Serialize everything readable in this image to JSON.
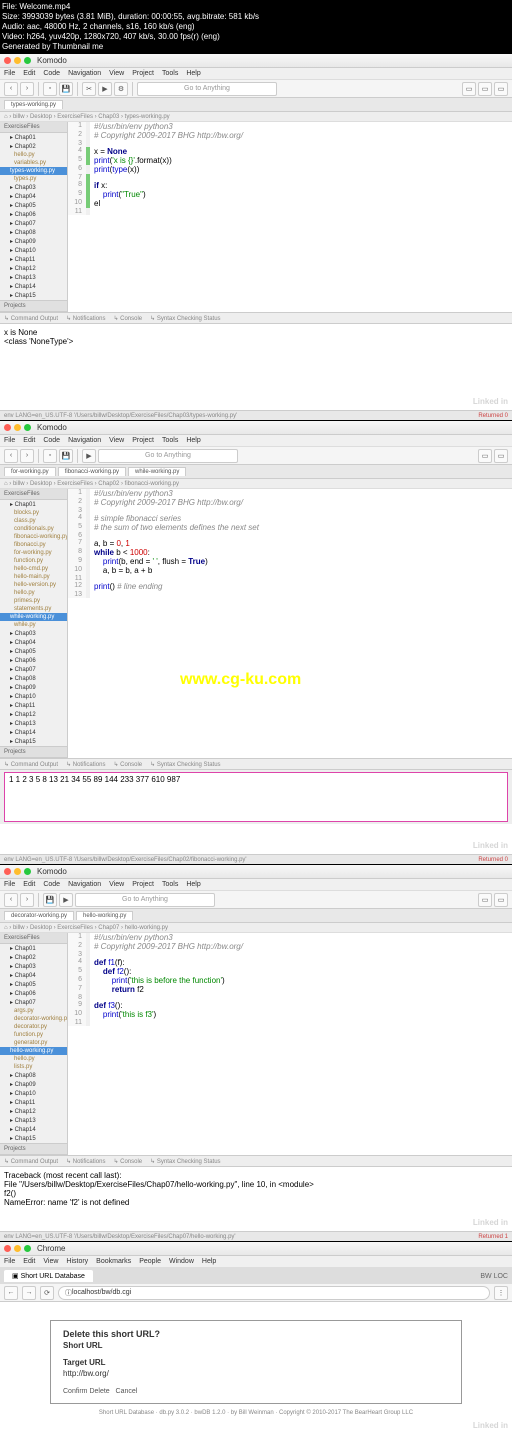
{
  "fileinfo": {
    "l1": "File: Welcome.mp4",
    "l2": "Size: 3993039 bytes (3.81 MiB), duration: 00:00:55, avg.bitrate: 581 kb/s",
    "l3": "Audio: aac, 48000 Hz, 2 channels, s16, 160 kb/s (eng)",
    "l4": "Video: h264, yuv420p, 1280x720, 407 kb/s, 30.00 fps(r) (eng)",
    "l5": "Generated by Thumbnail me"
  },
  "app": "Komodo",
  "menu": [
    "File",
    "Edit",
    "Code",
    "Navigation",
    "View",
    "Project",
    "Tools",
    "Help"
  ],
  "search_ph": "Go to Anything",
  "ide1": {
    "tab": "types-working.py",
    "sidebar_hdr": "ExerciseFiles",
    "items": [
      {
        "t": "Chap01",
        "c": "folder"
      },
      {
        "t": "Chap02",
        "c": "folder"
      },
      {
        "t": "hello.py",
        "c": "py"
      },
      {
        "t": "variables.py",
        "c": "py"
      },
      {
        "t": "types-working.py",
        "c": "sel"
      },
      {
        "t": "types.py",
        "c": "py"
      },
      {
        "t": "Chap03",
        "c": "folder"
      },
      {
        "t": "Chap04",
        "c": "folder"
      },
      {
        "t": "Chap05",
        "c": "folder"
      },
      {
        "t": "Chap06",
        "c": "folder"
      },
      {
        "t": "Chap07",
        "c": "folder"
      },
      {
        "t": "Chap08",
        "c": "folder"
      },
      {
        "t": "Chap09",
        "c": "folder"
      },
      {
        "t": "Chap10",
        "c": "folder"
      },
      {
        "t": "Chap11",
        "c": "folder"
      },
      {
        "t": "Chap12",
        "c": "folder"
      },
      {
        "t": "Chap13",
        "c": "folder"
      },
      {
        "t": "Chap14",
        "c": "folder"
      },
      {
        "t": "Chap15",
        "c": "folder"
      }
    ],
    "code": [
      {
        "n": "1",
        "g": "",
        "h": "<span class='com'>#!/usr/bin/env python3</span>"
      },
      {
        "n": "2",
        "g": "",
        "h": "<span class='com'># Copyright 2009-2017 BHG http://bw.org/</span>"
      },
      {
        "n": "3",
        "g": "",
        "h": ""
      },
      {
        "n": "4",
        "g": "green",
        "h": "x = <span class='kw'>None</span>"
      },
      {
        "n": "5",
        "g": "green",
        "h": "<span class='fn'>print</span>(<span class='str'>'x is {}'</span>.format(x))"
      },
      {
        "n": "6",
        "g": "",
        "h": "<span class='fn'>print</span>(<span class='fn'>type</span>(x))"
      },
      {
        "n": "7",
        "g": "green",
        "h": ""
      },
      {
        "n": "8",
        "g": "green",
        "h": "<span class='kw'>if</span> x:"
      },
      {
        "n": "9",
        "g": "green",
        "h": "    <span class='fn'>print</span>(<span class='str'>\"True\"</span>)"
      },
      {
        "n": "10",
        "g": "green",
        "h": "el"
      },
      {
        "n": "11",
        "g": "",
        "h": ""
      }
    ],
    "panel_tabs": [
      "Command Output",
      "Notifications",
      "Console",
      "Syntax Checking Status"
    ],
    "out1": "x is None",
    "out2": "<class 'NoneType'>",
    "status": "env LANG=en_US.UTF-8 '/Users/billw/Desktop/ExerciseFiles/Chap03/types-working.py'",
    "status_r": "Returned 0"
  },
  "ide2": {
    "tabs": [
      "for-working.py",
      "fibonacci-working.py",
      "while-working.py"
    ],
    "items": [
      {
        "t": "Chap01",
        "c": "folder"
      },
      {
        "t": "blocks.py",
        "c": "py"
      },
      {
        "t": "class.py",
        "c": "py"
      },
      {
        "t": "conditionals.py",
        "c": "py"
      },
      {
        "t": "fibonacci-working.py",
        "c": "py"
      },
      {
        "t": "fibonacci.py",
        "c": "py"
      },
      {
        "t": "for-working.py",
        "c": "py"
      },
      {
        "t": "function.py",
        "c": "py"
      },
      {
        "t": "hello-cmd.py",
        "c": "py"
      },
      {
        "t": "hello-main.py",
        "c": "py"
      },
      {
        "t": "hello-version.py",
        "c": "py"
      },
      {
        "t": "hello.py",
        "c": "py"
      },
      {
        "t": "primes.py",
        "c": "py"
      },
      {
        "t": "statements.py",
        "c": "py"
      },
      {
        "t": "while-working.py",
        "c": "sel"
      },
      {
        "t": "while.py",
        "c": "py"
      },
      {
        "t": "Chap03",
        "c": "folder"
      },
      {
        "t": "Chap04",
        "c": "folder"
      },
      {
        "t": "Chap05",
        "c": "folder"
      },
      {
        "t": "Chap06",
        "c": "folder"
      },
      {
        "t": "Chap07",
        "c": "folder"
      },
      {
        "t": "Chap08",
        "c": "folder"
      },
      {
        "t": "Chap09",
        "c": "folder"
      },
      {
        "t": "Chap10",
        "c": "folder"
      },
      {
        "t": "Chap11",
        "c": "folder"
      },
      {
        "t": "Chap12",
        "c": "folder"
      },
      {
        "t": "Chap13",
        "c": "folder"
      },
      {
        "t": "Chap14",
        "c": "folder"
      },
      {
        "t": "Chap15",
        "c": "folder"
      }
    ],
    "code": [
      {
        "n": "1",
        "h": "<span class='com'>#!/usr/bin/env python3</span>"
      },
      {
        "n": "2",
        "h": "<span class='com'># Copyright 2009-2017 BHG http://bw.org/</span>"
      },
      {
        "n": "3",
        "h": ""
      },
      {
        "n": "4",
        "h": "<span class='com'># simple fibonacci series</span>"
      },
      {
        "n": "5",
        "h": "<span class='com'># the sum of two elements defines the next set</span>"
      },
      {
        "n": "6",
        "h": ""
      },
      {
        "n": "7",
        "h": "a, b = <span class='num'>0</span>, <span class='num'>1</span>"
      },
      {
        "n": "8",
        "h": "<span class='kw'>while</span> b &lt; <span class='num'>1000</span>:"
      },
      {
        "n": "9",
        "h": "    <span class='fn'>print</span>(b, end = <span class='str'>' '</span>, flush = <span class='kw'>True</span>)"
      },
      {
        "n": "10",
        "h": "    a, b = b, a + b"
      },
      {
        "n": "11",
        "h": ""
      },
      {
        "n": "12",
        "h": "<span class='fn'>print</span>() <span class='com'># line ending</span>"
      },
      {
        "n": "13",
        "h": ""
      }
    ],
    "out": "1 1 2 3 5 8 13 21 34 55 89 144 233 377 610 987",
    "status": "env LANG=en_US.UTF-8 '/Users/billw/Desktop/ExerciseFiles/Chap02/fibonacci-working.py'",
    "status_r": "Returned 0"
  },
  "watermark": "www.cg-ku.com",
  "ide3": {
    "tabs": [
      "decorator-working.py",
      "hello-working.py"
    ],
    "items": [
      {
        "t": "Chap01",
        "c": "folder"
      },
      {
        "t": "Chap02",
        "c": "folder"
      },
      {
        "t": "Chap03",
        "c": "folder"
      },
      {
        "t": "Chap04",
        "c": "folder"
      },
      {
        "t": "Chap05",
        "c": "folder"
      },
      {
        "t": "Chap06",
        "c": "folder"
      },
      {
        "t": "Chap07",
        "c": "folder"
      },
      {
        "t": "args.py",
        "c": "py"
      },
      {
        "t": "decorator-working.py",
        "c": "py"
      },
      {
        "t": "decorator.py",
        "c": "py"
      },
      {
        "t": "function.py",
        "c": "py"
      },
      {
        "t": "generator.py",
        "c": "py"
      },
      {
        "t": "hello-working.py",
        "c": "sel"
      },
      {
        "t": "hello.py",
        "c": "py"
      },
      {
        "t": "lists.py",
        "c": "py"
      },
      {
        "t": "Chap08",
        "c": "folder"
      },
      {
        "t": "Chap09",
        "c": "folder"
      },
      {
        "t": "Chap10",
        "c": "folder"
      },
      {
        "t": "Chap11",
        "c": "folder"
      },
      {
        "t": "Chap12",
        "c": "folder"
      },
      {
        "t": "Chap13",
        "c": "folder"
      },
      {
        "t": "Chap14",
        "c": "folder"
      },
      {
        "t": "Chap15",
        "c": "folder"
      }
    ],
    "code": [
      {
        "n": "1",
        "h": "<span class='com'>#!/usr/bin/env python3</span>"
      },
      {
        "n": "2",
        "h": "<span class='com'># Copyright 2009-2017 BHG http://bw.org/</span>"
      },
      {
        "n": "3",
        "h": ""
      },
      {
        "n": "4",
        "h": "<span class='kw'>def</span> <span class='fn'>f1</span>(f):"
      },
      {
        "n": "5",
        "h": "    <span class='kw'>def</span> <span class='fn'>f2</span>():"
      },
      {
        "n": "6",
        "h": "        <span class='fn'>print</span>(<span class='str'>'this is before the function'</span>)"
      },
      {
        "n": "7",
        "h": "        <span class='kw'>return</span> f2"
      },
      {
        "n": "8",
        "h": ""
      },
      {
        "n": "9",
        "h": "<span class='kw'>def</span> <span class='fn'>f3</span>():"
      },
      {
        "n": "10",
        "h": "    <span class='fn'>print</span>(<span class='str'>'this is f3'</span>)"
      },
      {
        "n": "11",
        "h": ""
      }
    ],
    "out1": "Traceback (most recent call last):",
    "out2": "  File \"/Users/billw/Desktop/ExerciseFiles/Chap07/hello-working.py\", line 10, in <module>",
    "out3": "    f2()",
    "out4": "NameError: name 'f2' is not defined",
    "status": "env LANG=en_US.UTF-8 '/Users/billw/Desktop/ExerciseFiles/Chap07/hello-working.py'",
    "status_r": "Returned 1"
  },
  "browser": {
    "app": "Chrome",
    "menu": [
      "File",
      "Edit",
      "View",
      "History",
      "Bookmarks",
      "People",
      "Window",
      "Help"
    ],
    "tab": "Short URL Database",
    "right": "BW LOC",
    "addr": "localhost/bw/db.cgi",
    "h": "Delete this short URL?",
    "sub": "Short URL",
    "lbl": "Target URL",
    "val": "http://bw.org/",
    "btn1": "Confirm Delete",
    "btn2": "Cancel",
    "foot": "Short URL Database · db.py 3.0.2 · bwDB 1.2.0 · by Bill Weinman · Copyright © 2010-2017 The BearHeart Group LLC"
  },
  "proj": "Projects",
  "linkedin": "Linked in"
}
